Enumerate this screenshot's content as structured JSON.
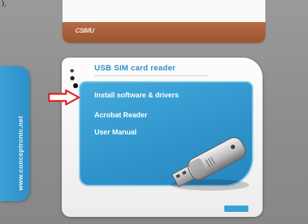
{
  "caption": "),",
  "brand_strip": {
    "label": "CSIMU"
  },
  "side_tab": {
    "url": "www.conceptronic.net"
  },
  "panel": {
    "title": "USB SIM card reader",
    "menu": [
      {
        "label": "Install software & drivers"
      },
      {
        "label": "Acrobat Reader"
      },
      {
        "label": "User Manual"
      }
    ]
  },
  "colors": {
    "background": "#8f8f8f",
    "accent_blue": "#2f93ca",
    "brown_strip": "#a85c38",
    "arrow": "#e02020"
  },
  "icons": [
    "red-arrow-icon",
    "usb-stick-icon"
  ]
}
